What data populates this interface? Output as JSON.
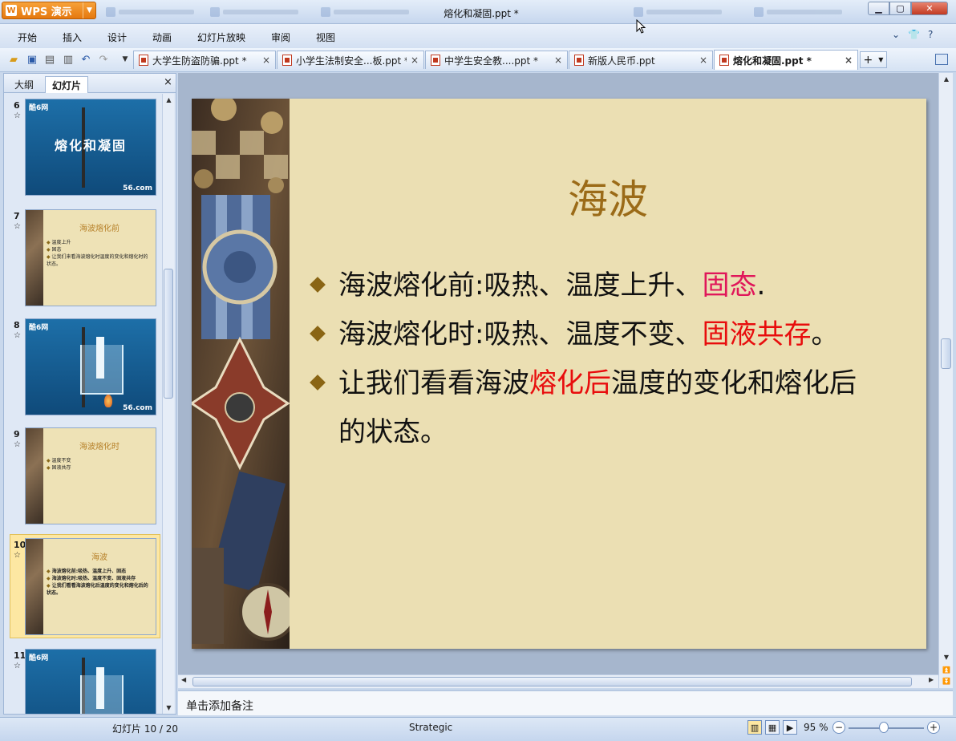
{
  "app": {
    "name": "WPS 演示",
    "window_title": "熔化和凝固.ppt *"
  },
  "menu": [
    "开始",
    "插入",
    "设计",
    "动画",
    "幻灯片放映",
    "审阅",
    "视图"
  ],
  "menu_right": {
    "collapse": "⌄",
    "skin": "👕",
    "help": "?"
  },
  "doc_tabs": [
    {
      "label": "大学生防盗防骗.ppt *",
      "close": "×"
    },
    {
      "label": "小学生法制安全...板.ppt *",
      "close": "×"
    },
    {
      "label": "中学生安全教....ppt *",
      "close": "×"
    },
    {
      "label": "新版人民币.ppt",
      "close": "×"
    },
    {
      "label": "熔化和凝固.ppt *",
      "close": "×",
      "active": true
    }
  ],
  "left_panel": {
    "tab_outline": "大纲",
    "tab_slides": "幻灯片",
    "close": "×"
  },
  "thumbnails": [
    {
      "num": "6",
      "star": "☆",
      "kind": "video",
      "logo": "酷6网",
      "text": "熔化和凝固",
      "site": "56.com"
    },
    {
      "num": "7",
      "star": "☆",
      "kind": "slide",
      "title": "海波熔化前",
      "bullets": [
        "温度上升",
        "固态",
        "让我们来看海波熔化时温度的变化和熔化时的状态。"
      ]
    },
    {
      "num": "8",
      "star": "☆",
      "kind": "video",
      "logo": "酷6网",
      "text": "",
      "site": "56.com"
    },
    {
      "num": "9",
      "star": "☆",
      "kind": "slide",
      "title": "海波熔化时",
      "bullets": [
        "温度不变",
        "固液共存"
      ]
    },
    {
      "num": "10",
      "star": "☆",
      "kind": "slide",
      "selected": true,
      "title": "海波",
      "bullets": [
        "海波熔化前:吸热、温度上升、固态",
        "海波熔化时:吸热、温度不变、固液共存",
        "让我们看看海波熔化后温度的变化和熔化后的状态。"
      ]
    },
    {
      "num": "11",
      "star": "☆",
      "kind": "video",
      "logo": "酷6网",
      "text": "",
      "site": ""
    }
  ],
  "slide": {
    "title": "海波",
    "bullets": [
      {
        "parts": [
          {
            "text": "海波熔化前:吸热、温度上升、"
          },
          {
            "text": "固态",
            "style": "pink"
          },
          {
            "text": "."
          }
        ]
      },
      {
        "parts": [
          {
            "text": "海波熔化时:吸热、温度不变、"
          },
          {
            "text": "固液共存",
            "style": "red"
          },
          {
            "text": "。"
          }
        ]
      },
      {
        "parts": [
          {
            "text": "让我们看看海波"
          },
          {
            "text": "熔化后",
            "style": "red"
          },
          {
            "text": "温度的变化和熔化后的状态。"
          }
        ]
      }
    ]
  },
  "notes_placeholder": "单击添加备注",
  "status": {
    "slide_counter": "幻灯片 10 / 20",
    "theme": "Strategic",
    "zoom": "95 %",
    "zoom_level_pct": 95
  },
  "colors": {
    "accent_orange": "#e5780e",
    "title_gold": "#9b6b18",
    "highlight_red": "#e80d0d",
    "highlight_pink": "#e0175a",
    "slide_bg": "#ebdfb3"
  }
}
